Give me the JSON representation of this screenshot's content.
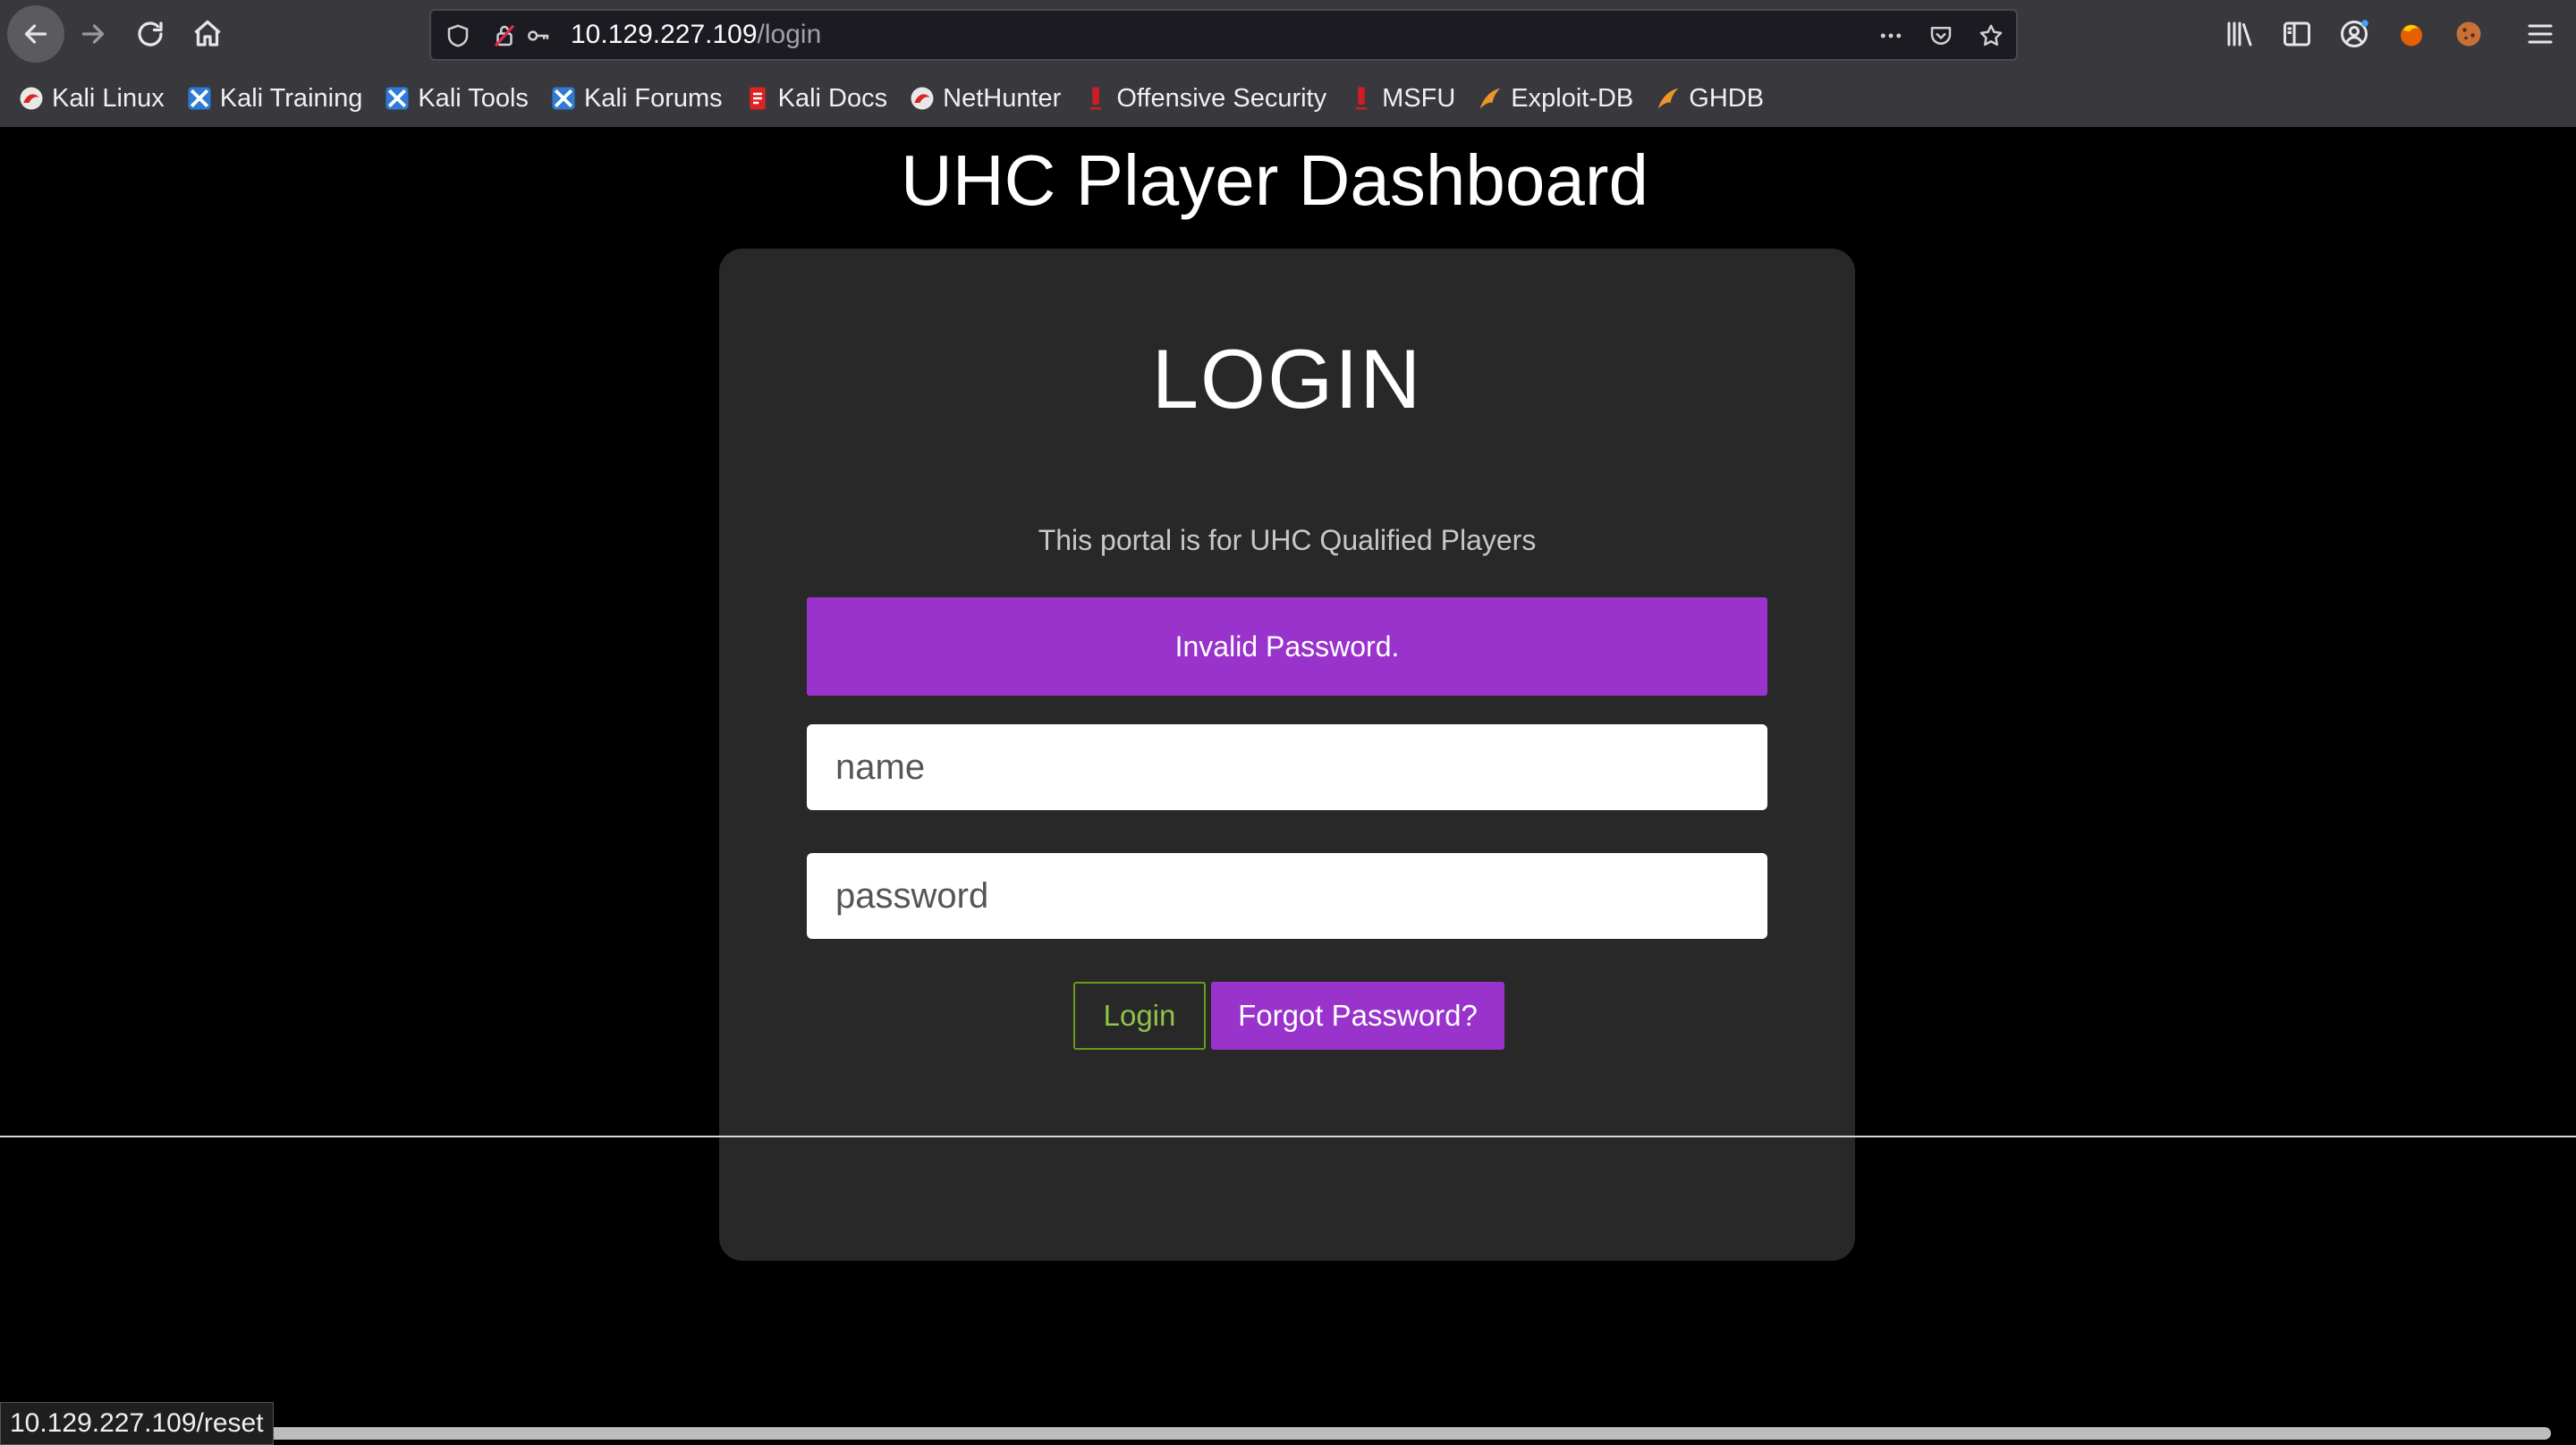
{
  "browser": {
    "url_host": "10.129.227.109",
    "url_path": "/login",
    "bookmarks": [
      {
        "label": "Kali Linux",
        "icon": "kali-dragon-icon"
      },
      {
        "label": "Kali Training",
        "icon": "kali-tools-icon"
      },
      {
        "label": "Kali Tools",
        "icon": "kali-tools-icon"
      },
      {
        "label": "Kali Forums",
        "icon": "kali-tools-icon"
      },
      {
        "label": "Kali Docs",
        "icon": "kali-docs-icon"
      },
      {
        "label": "NetHunter",
        "icon": "kali-dragon-icon"
      },
      {
        "label": "Offensive Security",
        "icon": "offsec-icon"
      },
      {
        "label": "MSFU",
        "icon": "offsec-icon"
      },
      {
        "label": "Exploit-DB",
        "icon": "exploitdb-icon"
      },
      {
        "label": "GHDB",
        "icon": "exploitdb-icon"
      }
    ],
    "status_url": "10.129.227.109/reset"
  },
  "page": {
    "title": "UHC Player Dashboard",
    "heading": "LOGIN",
    "subtitle": "This portal is for UHC Qualified Players",
    "alert": "Invalid Password.",
    "name_placeholder": "name",
    "password_placeholder": "password",
    "login_label": "Login",
    "forgot_label": "Forgot Password?"
  },
  "colors": {
    "accent": "#9933cc",
    "login_green": "#8fc34a",
    "card_bg": "#282828"
  }
}
